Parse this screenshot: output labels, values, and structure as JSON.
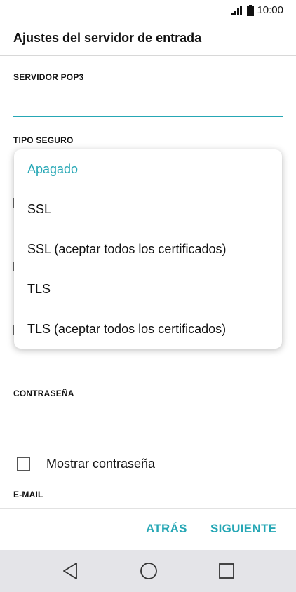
{
  "status_bar": {
    "time": "10:00",
    "signal_icon": "signal-icon",
    "battery_icon": "battery-icon"
  },
  "header": {
    "title": "Ajustes del servidor de entrada"
  },
  "form": {
    "server_label": "SERVIDOR POP3",
    "server_value": "",
    "security_label": "TIPO SEGURO",
    "password_label": "CONTRASEÑA",
    "password_value": "",
    "show_password_label": "Mostrar contraseña",
    "show_password_checked": false,
    "email_label": "E-MAIL"
  },
  "dropdown": {
    "options": [
      {
        "label": "Apagado",
        "selected": true
      },
      {
        "label": "SSL",
        "selected": false
      },
      {
        "label": "SSL (aceptar todos los certificados)",
        "selected": false
      },
      {
        "label": "TLS",
        "selected": false
      },
      {
        "label": "TLS (aceptar todos los certificados)",
        "selected": false
      }
    ]
  },
  "actions": {
    "back": "ATRÁS",
    "next": "SIGUIENTE"
  },
  "nav": {
    "back_icon": "nav-back-icon",
    "home_icon": "nav-home-icon",
    "recents_icon": "nav-recents-icon"
  },
  "colors": {
    "accent": "#26a7b5",
    "nav_background": "#e4e4e8"
  }
}
